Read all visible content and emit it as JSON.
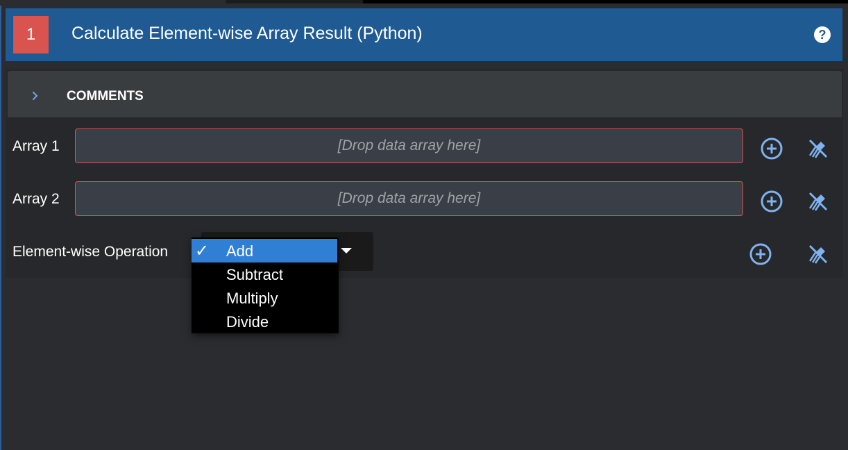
{
  "header": {
    "step_number": "1",
    "title": "Calculate Element-wise Array Result (Python)",
    "help_icon": "question-circle-icon",
    "colors": {
      "header_bg": "#1f5a93",
      "badge_bg": "#d9534f"
    }
  },
  "comments": {
    "label": "COMMENTS",
    "toggle_icon": "chevron-right-icon"
  },
  "fields": [
    {
      "label": "Array 1",
      "placeholder": "[Drop data array here]"
    },
    {
      "label": "Array 2",
      "placeholder": "[Drop data array here]"
    },
    {
      "label": "Element-wise Operation",
      "selected": "Add"
    }
  ],
  "operation_dropdown": {
    "options": [
      "Add",
      "Subtract",
      "Multiply",
      "Divide"
    ],
    "selected_index": 0,
    "check_glyph": "✓"
  },
  "row_icons": {
    "add": "plus-circle-icon",
    "clear": "broom-icon"
  },
  "colors": {
    "accent": "#2f7fd4",
    "error_border": "#d9534f",
    "icon": "#7fb2ee"
  }
}
